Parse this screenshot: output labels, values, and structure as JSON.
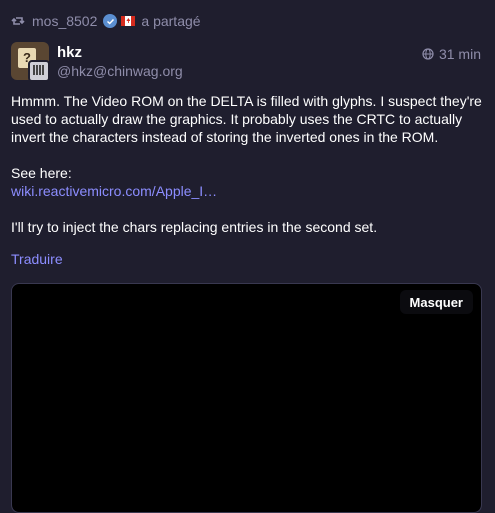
{
  "boost": {
    "booster_name": "mos_8502",
    "shared_label": "a partagé"
  },
  "author": {
    "display_name": "hkz",
    "account": "@hkz@chinwag.org"
  },
  "status": {
    "relative_time": "31 min",
    "paragraph_1": "Hmmm. The Video ROM on the DELTA is filled with glyphs. I suspect they're used to actually draw the graphics. It probably uses the CRTC to actually invert the characters instead of storing the inverted ones in the ROM.",
    "see_here": "See here:",
    "link_text": "wiki.reactivemicro.com/Apple_I…",
    "paragraph_3": "I'll try to inject the chars replacing entries in the second set."
  },
  "actions": {
    "translate_label": "Traduire",
    "hide_media_label": "Masquer"
  },
  "icons": {
    "boost": "boost-icon",
    "verified": "verified-badge-icon",
    "flag": "canada-flag-icon",
    "visibility": "globe-icon"
  },
  "colors": {
    "background": "#1f1e2e",
    "muted_text": "#8f8daa",
    "link": "#8c8dff",
    "media_bg": "#000000"
  }
}
